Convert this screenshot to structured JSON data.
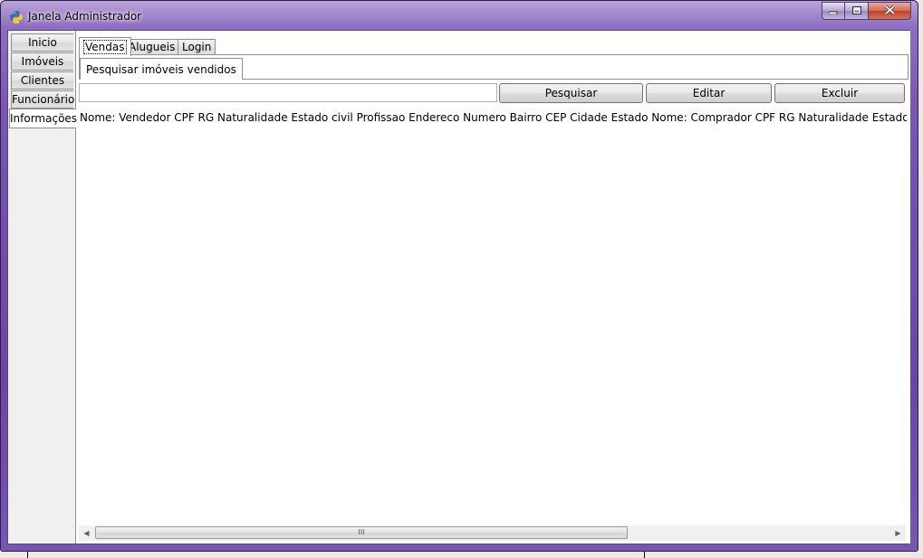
{
  "window": {
    "title": "Janela Administrador"
  },
  "side_tabs": [
    "Inicio",
    "Imóveis",
    "Clientes",
    "Funcionário",
    "Informações"
  ],
  "top_tabs": [
    "Vendas",
    "Alugueis",
    "Login"
  ],
  "sub_tab": "Pesquisar imóveis vendidos",
  "search": {
    "value": "",
    "placeholder": ""
  },
  "buttons": {
    "search": "Pesquisar",
    "edit": "Editar",
    "delete": "Excluir"
  },
  "table": {
    "header": "Nome: Vendedor CPF RG Naturalidade Estado civil Profissao Endereco Numero Bairro CEP Cidade Estado Nome: Comprador CPF RG Naturalidade Estado Civil Profissao Endereco"
  },
  "scrollbar": {
    "grip": "III"
  },
  "colors": {
    "frame_accent": "#7a55b3",
    "close_button": "#c0402a"
  }
}
